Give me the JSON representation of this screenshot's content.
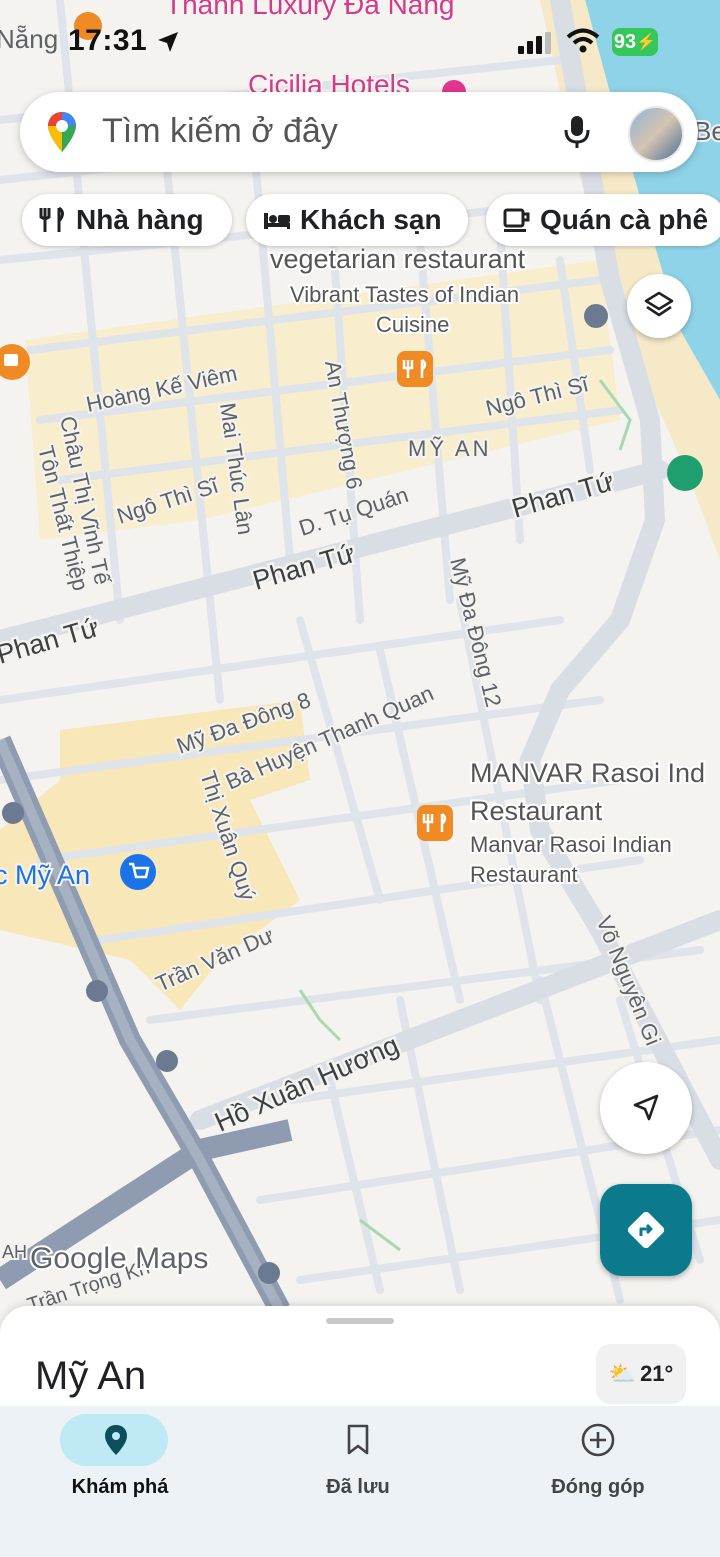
{
  "status_bar": {
    "time": "17:31",
    "battery": "93"
  },
  "search": {
    "placeholder": "Tìm kiếm ở đây"
  },
  "chips": [
    {
      "label": "Nhà hàng",
      "icon": "restaurant-icon"
    },
    {
      "label": "Khách sạn",
      "icon": "hotel-icon"
    },
    {
      "label": "Quán cà phê",
      "icon": "coffee-icon"
    }
  ],
  "map": {
    "streets": {
      "phan_tu_1": "Phan Tứ",
      "phan_tu_2": "Phan Tứ",
      "phan_tu_3": "Phan Tứ",
      "hoang_ke_viem": "Hoàng Kế Viêm",
      "ngo_thi_si_1": "Ngô Thì Sĩ",
      "ngo_thi_si_2": "Ngô Thì Sĩ",
      "chau_thi_vinh_te": "Châu Thị Vĩnh Tế",
      "ton_that_thiep": "Tôn Thất Thiệp",
      "mai_thuc_lan": "Mai Thúc Lân",
      "an_thuong_6": "An Thượng 6",
      "d_tu_quan": "D. Tụ Quán",
      "my_da_dong_12": "Mỹ Đa Đông 12",
      "my_da_dong_8": "Mỹ Đa Đông 8",
      "ba_huyen_thanh_quan": "Bà Huyện Thanh Quan",
      "thi_xuan_quy": "Thị Xuân Quý",
      "tran_van_du": "Trần Văn Dư",
      "ho_xuan_huong": "Hồ Xuân Hương",
      "vo_nguyen_giap": "Võ Nguyên Gi",
      "tran_trong_khiem": "Trần Trọng Kh"
    },
    "areas": {
      "my_an": "MỸ AN",
      "nang": "Nẵng"
    },
    "pois": {
      "thanh_luxury": "Thanh Luxury Đà Nẵng",
      "cicilia": "Cicilia Hotels",
      "vegetarian": "vegetarian restaurant",
      "vibrant_1": "Vibrant Tastes of Indian",
      "vibrant_2": "Cuisine",
      "manvar_1": "MANVAR Rasoi Ind",
      "manvar_2": "Restaurant",
      "manvar_3": "Manvar Rasoi Indian",
      "manvar_4": "Restaurant",
      "cho_my_an": "c Mỹ An",
      "be": "Be",
      "ah": "AH"
    },
    "branding": "Google Maps"
  },
  "sheet": {
    "title": "Mỹ An",
    "temperature": "21°"
  },
  "bottom_nav": [
    {
      "label": "Khám phá",
      "active": true
    },
    {
      "label": "Đã lưu",
      "active": false
    },
    {
      "label": "Đóng góp",
      "active": false
    }
  ],
  "colors": {
    "accent": "#0b7a8c",
    "restaurant_pin": "#f08a24",
    "water": "#8fd3e8",
    "beach": "#f5e9c8",
    "highway": "#8e9bb0"
  }
}
